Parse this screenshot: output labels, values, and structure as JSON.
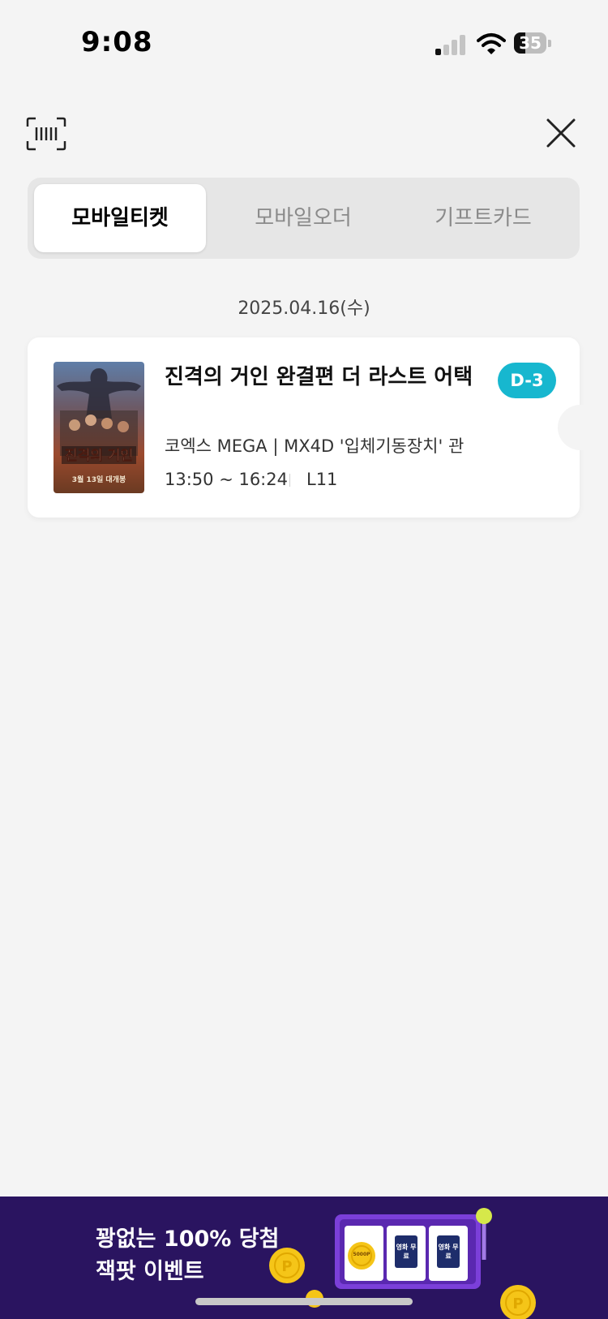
{
  "status_bar": {
    "time": "9:08",
    "battery_level": "35"
  },
  "tabs": [
    {
      "label": "모바일티켓",
      "active": true
    },
    {
      "label": "모바일오더",
      "active": false
    },
    {
      "label": "기프트카드",
      "active": false
    }
  ],
  "date_label": "2025.04.16(수)",
  "ticket": {
    "poster_title": "진격의 거인",
    "poster_release": "3월 13일 대개봉",
    "title": "진격의 거인 완결편 더 라스트 어택",
    "dday": "D-3",
    "theater": "코엑스 MEGA | MX4D '입체기동장치' 관",
    "showtime": "13:50 ~ 16:24",
    "seat": "L11"
  },
  "banner": {
    "line1": "꽝없는 100% 당첨",
    "line2": "잭팟 이벤트",
    "slot_reels": [
      "5000P",
      "영화 무료",
      "영화 무료"
    ]
  },
  "colors": {
    "accent": "#17b7cf",
    "banner_bg": "#2a1460",
    "slot_purple": "#7b3fd9",
    "coin": "#f5c518"
  },
  "icons": [
    "barcode-scan-icon",
    "close-icon",
    "cellular-signal-icon",
    "wifi-icon",
    "battery-icon",
    "coin-icon"
  ]
}
